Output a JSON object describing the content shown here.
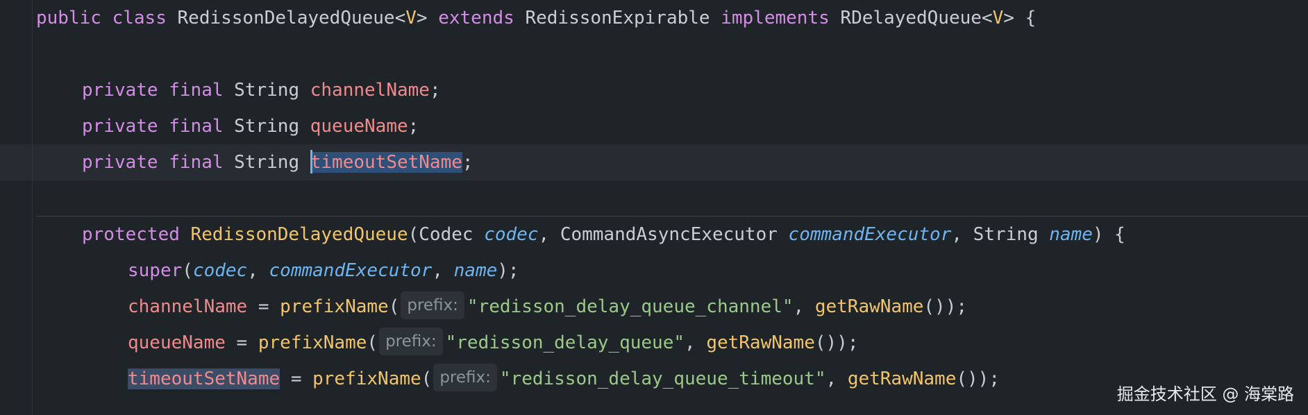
{
  "code": {
    "l1": {
      "kw_public": "public",
      "kw_class": "class",
      "class_name": "RedissonDelayedQueue",
      "lt": "<",
      "type_param": "V",
      "gt": ">",
      "kw_extends": "extends",
      "super_class": "RedissonExpirable",
      "kw_implements": "implements",
      "interface_name": "RDelayedQueue",
      "lt2": "<",
      "type_param2": "V",
      "gt2": ">",
      "brace": "{"
    },
    "fields": [
      {
        "mod1": "private",
        "mod2": "final",
        "type": "String",
        "name": "channelName",
        "semi": ";"
      },
      {
        "mod1": "private",
        "mod2": "final",
        "type": "String",
        "name": "queueName",
        "semi": ";"
      },
      {
        "mod1": "private",
        "mod2": "final",
        "type": "String",
        "name": "timeoutSetName",
        "semi": ";"
      }
    ],
    "ctor": {
      "kw_protected": "protected",
      "name": "RedissonDelayedQueue",
      "open": "(",
      "p1_type": "Codec",
      "p1_name": "codec",
      "comma1": ",",
      "p2_type": "CommandAsyncExecutor",
      "p2_name": "commandExecutor",
      "comma2": ",",
      "p3_type": "String",
      "p3_name": "name",
      "close_brace": ") {"
    },
    "super_call": {
      "kw_super": "super",
      "open": "(",
      "a1": "codec",
      "c1": ",",
      "a2": "commandExecutor",
      "c2": ",",
      "a3": "name",
      "close": ");"
    },
    "assigns": [
      {
        "field": "channelName",
        "eq": "=",
        "fn": "prefixName",
        "open": "(",
        "hint": "prefix:",
        "str": "\"redisson_delay_queue_channel\"",
        "comma": ",",
        "fn2": "getRawName",
        "close": "());"
      },
      {
        "field": "queueName",
        "eq": "=",
        "fn": "prefixName",
        "open": "(",
        "hint": "prefix:",
        "str": "\"redisson_delay_queue\"",
        "comma": ",",
        "fn2": "getRawName",
        "close": "());"
      },
      {
        "field": "timeoutSetName",
        "eq": "=",
        "fn": "prefixName",
        "open": "(",
        "hint": "prefix:",
        "str": "\"redisson_delay_queue_timeout\"",
        "comma": ",",
        "fn2": "getRawName",
        "close": "());"
      }
    ]
  },
  "watermark": "掘金技术社区 @ 海棠路",
  "colors": {
    "background": "#1f2428",
    "keyword": "#d48de6",
    "field": "#f08a8d",
    "function": "#f1c46d",
    "parameter": "#6fb4f2",
    "string": "#9bc98a",
    "selection": "#2e4f78"
  }
}
